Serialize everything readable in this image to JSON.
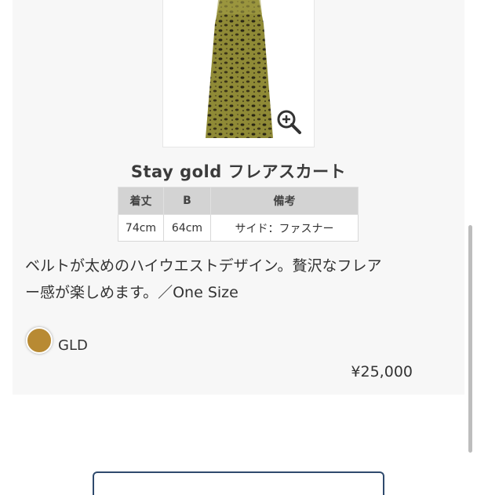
{
  "product": {
    "title": "Stay gold フレアスカート",
    "size_table": {
      "headers": [
        "着丈",
        "B",
        "備考"
      ],
      "row": [
        "74cm",
        "64cm",
        "サイド：ファスナー"
      ]
    },
    "description_line1": "ベルトが太めのハイウエストデザイン。贅沢なフレア",
    "description_line2": "ー感が楽しめます。／One Size",
    "color": {
      "name": "GLD",
      "swatch": "#b88a33"
    },
    "price": "¥25,000"
  },
  "icons": {
    "zoom": "zoom-in-icon"
  }
}
